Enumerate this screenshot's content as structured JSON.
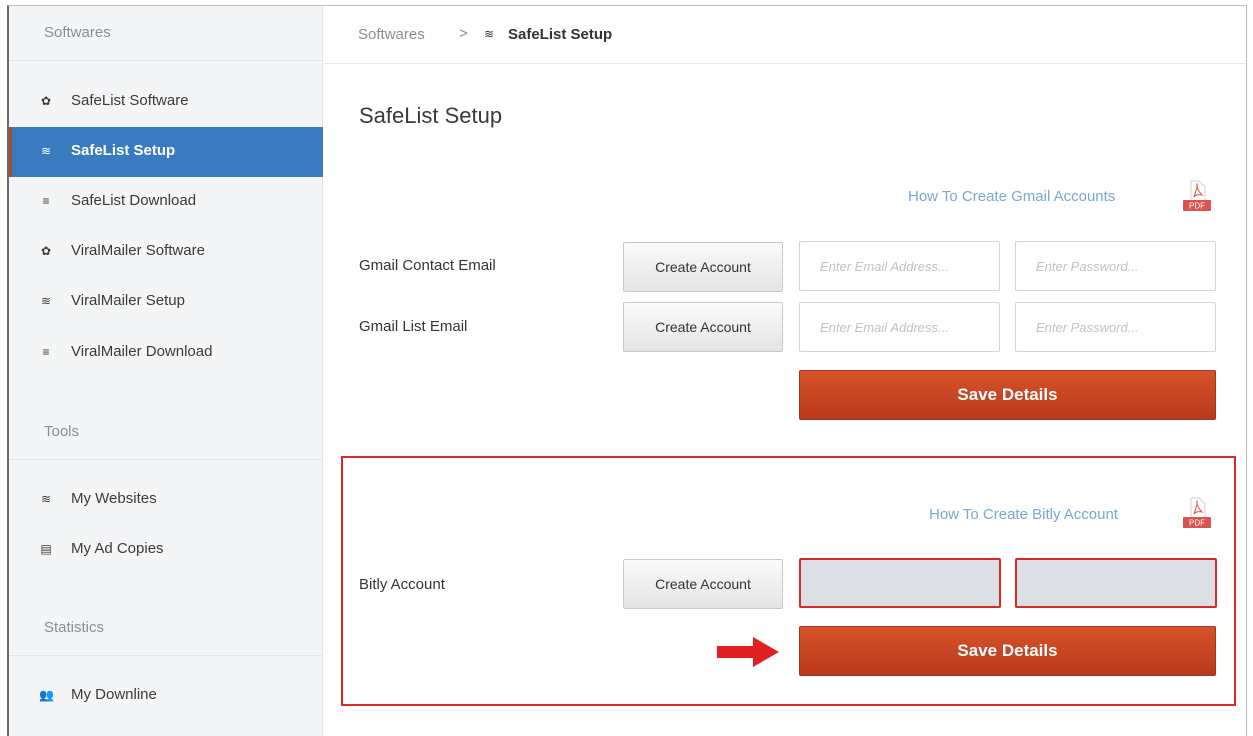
{
  "sidebar": {
    "sections": [
      {
        "title": "Softwares"
      },
      {
        "title": "Tools"
      },
      {
        "title": "Statistics"
      }
    ],
    "items": [
      {
        "label": "SafeList Software",
        "icon": "gear-icon"
      },
      {
        "label": "SafeList Setup",
        "icon": "layers-icon",
        "active": true
      },
      {
        "label": "SafeList Download",
        "icon": "download-icon"
      },
      {
        "label": "ViralMailer Software",
        "icon": "gear-icon"
      },
      {
        "label": "ViralMailer Setup",
        "icon": "layers-icon"
      },
      {
        "label": "ViralMailer Download",
        "icon": "download-icon"
      },
      {
        "label": "My Websites",
        "icon": "layers-icon"
      },
      {
        "label": "My Ad Copies",
        "icon": "list-icon"
      },
      {
        "label": "My Downline",
        "icon": "users-icon"
      }
    ]
  },
  "breadcrumb": {
    "root": "Softwares",
    "separator": ">",
    "current": "SafeList Setup"
  },
  "page_title": "SafeList Setup",
  "gmail": {
    "help_link": "How To Create Gmail Accounts",
    "rows": [
      {
        "label": "Gmail Contact Email",
        "button": "Create Account",
        "email_placeholder": "Enter Email Address...",
        "password_placeholder": "Enter Password..."
      },
      {
        "label": "Gmail List Email",
        "button": "Create Account",
        "email_placeholder": "Enter Email Address...",
        "password_placeholder": "Enter Password..."
      }
    ],
    "save": "Save Details"
  },
  "bitly": {
    "help_link": "How To Create Bitly Account",
    "label": "Bitly Account",
    "button": "Create Account",
    "save": "Save Details"
  },
  "pdf_badge": "PDF",
  "colors": {
    "accent_blue": "#3a7bbf",
    "save_red": "#c8431f",
    "highlight_red": "#d52b2b",
    "link_blue": "#7aa7d2"
  }
}
